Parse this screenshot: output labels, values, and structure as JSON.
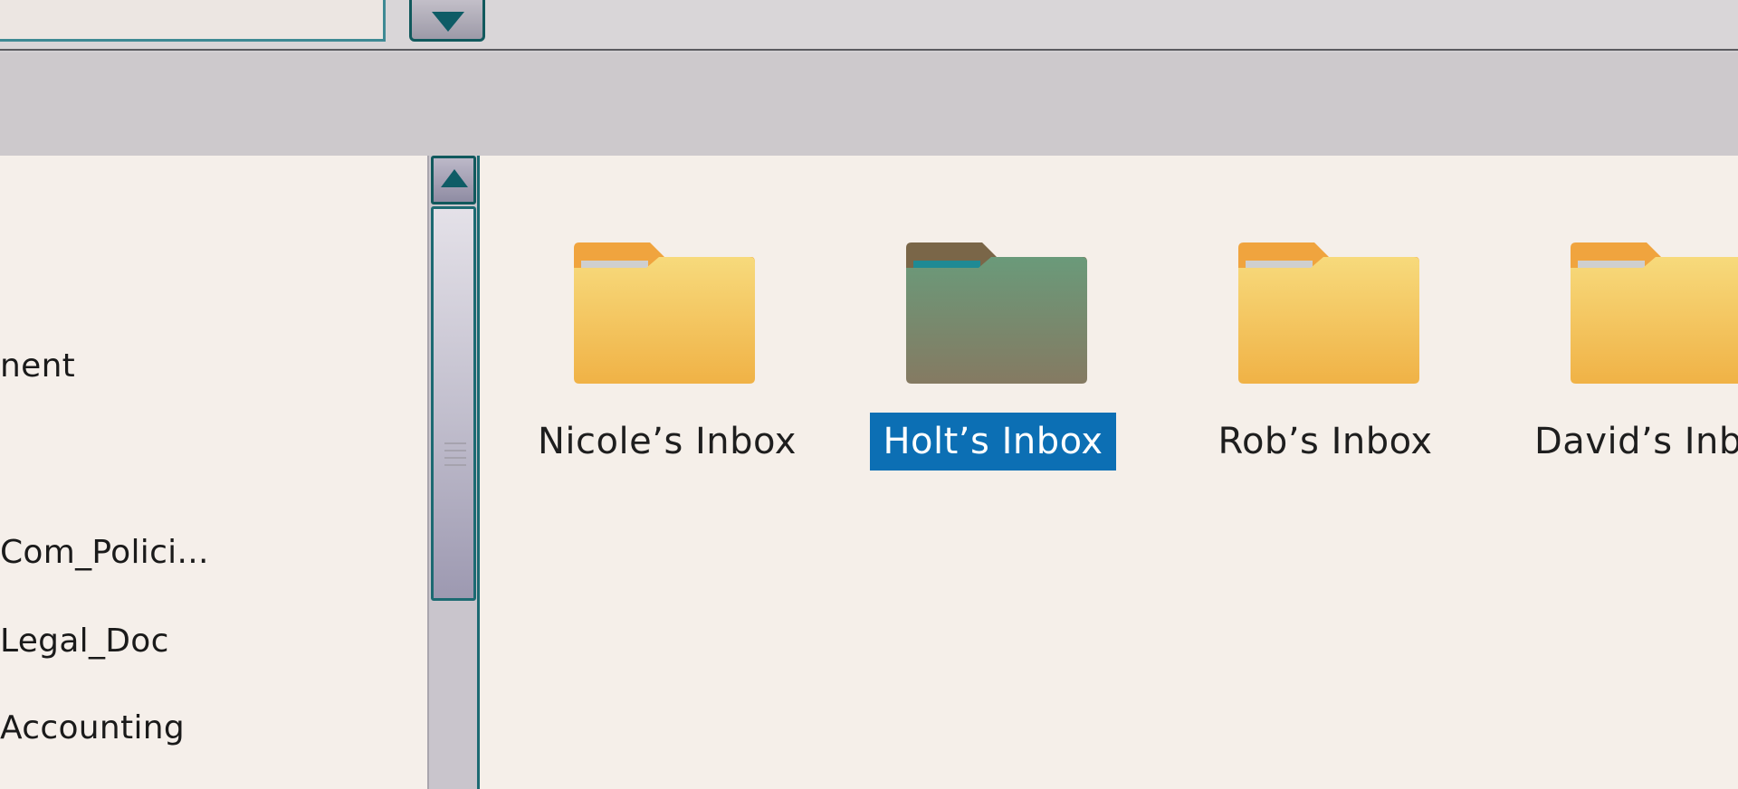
{
  "sidebar": {
    "items": [
      {
        "label": "nent"
      },
      {
        "label": "Com_Polici..."
      },
      {
        "label": "Legal_Doc"
      },
      {
        "label": "Accounting"
      }
    ]
  },
  "folders": [
    {
      "label": "Nicole’s Inbox",
      "selected": false
    },
    {
      "label": "Holt’s Inbox",
      "selected": true
    },
    {
      "label": "Rob’s Inbox",
      "selected": false
    },
    {
      "label": "David’s Inb",
      "selected": false
    }
  ],
  "colors": {
    "accent_teal": "#11595d",
    "selection_blue": "#0c6fb4",
    "folder_yellow": "#f3c65a",
    "folder_selected_green": "#6a9a7a"
  },
  "icons": {
    "dropdown": "chevron-down-icon",
    "scroll_up": "arrow-up-icon",
    "folder": "folder-icon"
  }
}
